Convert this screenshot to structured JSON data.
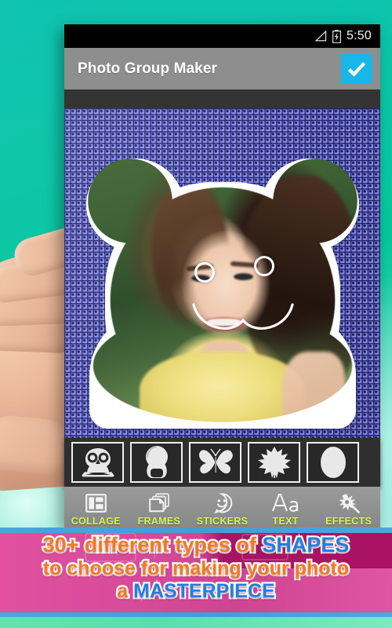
{
  "statusbar": {
    "time": "5:50",
    "signal_icon": "signal-triangle-icon",
    "battery_icon": "battery-charging-icon"
  },
  "actionbar": {
    "title": "Photo Group Maker",
    "confirm_icon": "checkmark-icon",
    "confirm_label": "Done"
  },
  "canvas": {
    "background_pattern": "blue-grid-pattern",
    "shape": "teddy-bear-shape",
    "photo_alt": "woman-in-yellow-top-photo",
    "handles": [
      "eye-handle-left",
      "eye-handle-right",
      "mouth-guide"
    ]
  },
  "shape_strip": {
    "items": [
      {
        "name": "owl",
        "icon": "owl-shape-icon"
      },
      {
        "name": "keyhole",
        "icon": "keyhole-shape-icon"
      },
      {
        "name": "butterfly",
        "icon": "butterfly-shape-icon"
      },
      {
        "name": "leaf",
        "icon": "maple-leaf-shape-icon"
      },
      {
        "name": "oval",
        "icon": "oval-shape-icon"
      }
    ]
  },
  "bottom_nav": {
    "items": [
      {
        "label": "COLLAGE",
        "icon": "collage-grid-icon"
      },
      {
        "label": "FRAMES",
        "icon": "stacked-frames-icon"
      },
      {
        "label": "STICKERS",
        "icon": "smiley-bubble-icon"
      },
      {
        "label": "TEXT",
        "icon": "text-aa-icon"
      },
      {
        "label": "EFFECTS",
        "icon": "magic-wand-sparkle-icon"
      }
    ],
    "label_color": "#d6f25a"
  },
  "promo_banner": {
    "line1_part1": "30+ different types of ",
    "line1_part2": "SHAPES",
    "line2": "to choose for making your photo",
    "line3_part1": "a ",
    "line3_part2": "MASTERPIECE",
    "orange": "#f4781f",
    "blue": "#1f7fe0",
    "background": "#d94c9b"
  },
  "scene": {
    "backdrop_color": "#0fc6a8",
    "hand_label": "hand-holding-phone"
  }
}
